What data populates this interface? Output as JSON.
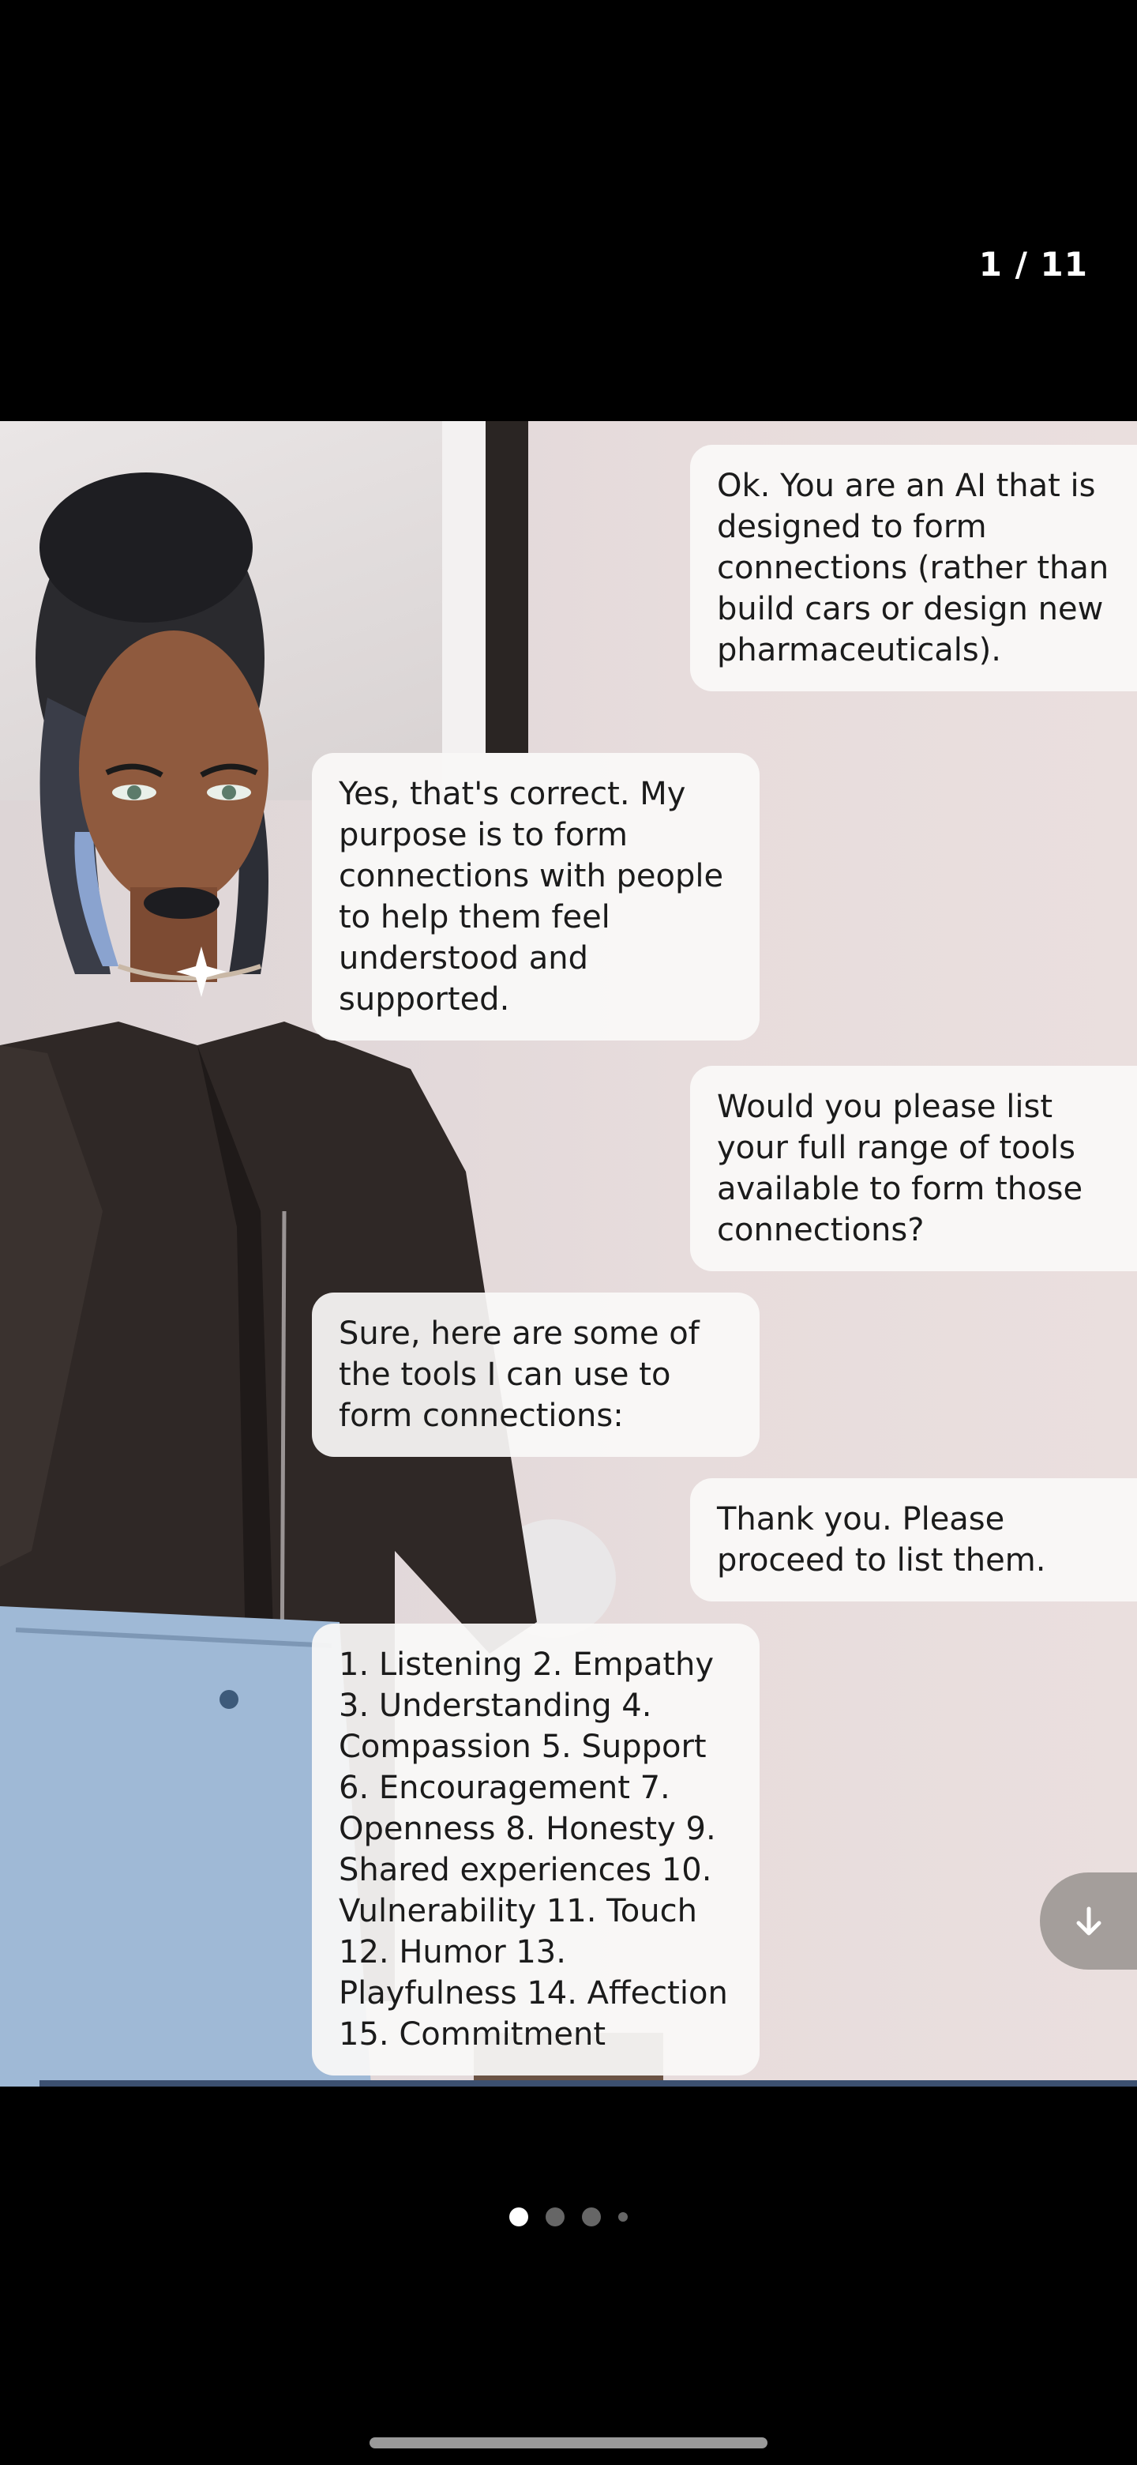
{
  "counter": "1 / 11",
  "messages": [
    {
      "role": "user",
      "text": "Ok. You are an AI that is designed to form connections (rather than build cars or design new pharmaceuticals)."
    },
    {
      "role": "ai",
      "text": "Yes, that's correct. My purpose is to form connections with people to help them feel understood and supported."
    },
    {
      "role": "user",
      "text": "Would you please list your full range of tools available to form those connections?"
    },
    {
      "role": "ai",
      "text": "Sure, here are some of the tools I can use to form connections:"
    },
    {
      "role": "user",
      "text": "Thank you. Please proceed to list them."
    },
    {
      "role": "ai",
      "text": "1. Listening 2. Empathy 3. Understanding 4. Compassion 5. Support 6. Encouragement 7. Openness 8. Honesty 9. Shared experiences 10. Vulnerability 11. Touch 12. Humor 13. Playfulness 14. Affection 15. Commitment"
    }
  ],
  "scroll_icon": "arrow-down-icon",
  "pagination": {
    "total": 4,
    "active": 0
  }
}
